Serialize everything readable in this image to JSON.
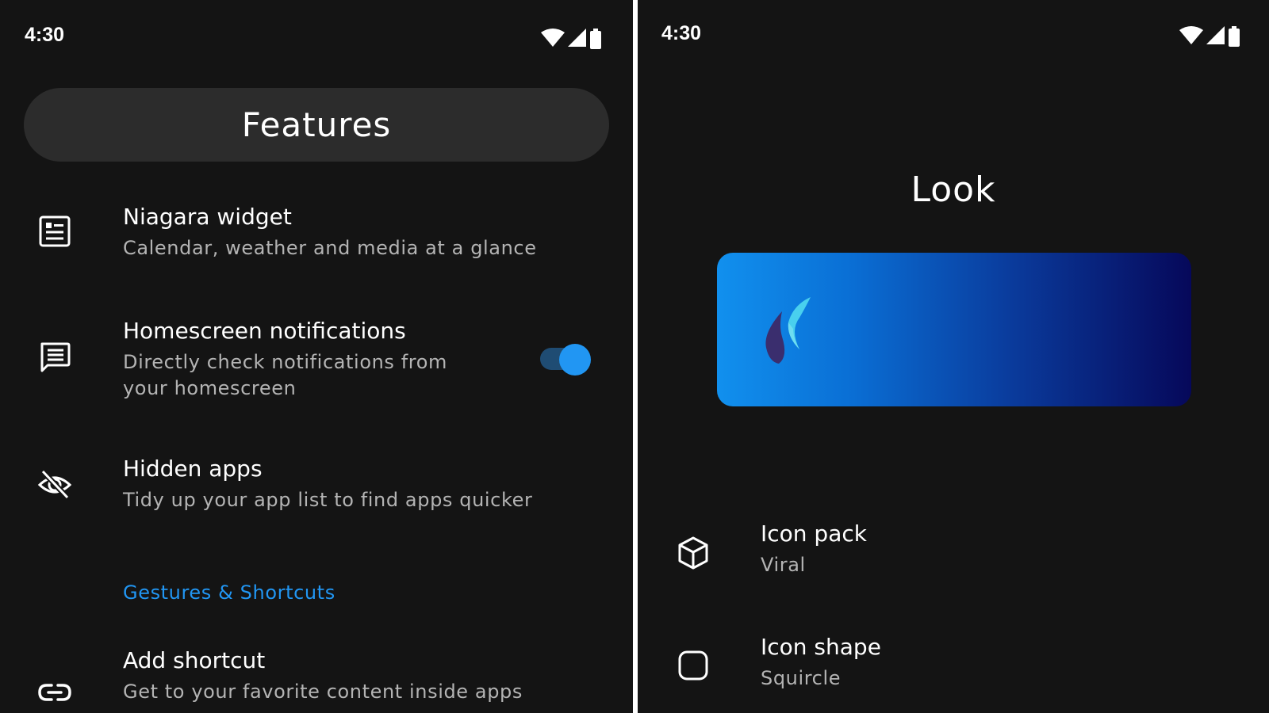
{
  "left_screen": {
    "status": {
      "time": "4:30"
    },
    "header": {
      "title": "Features"
    },
    "items": [
      {
        "icon": "article-icon",
        "title": "Niagara widget",
        "subtitle_lines": [
          "Calendar, weather and media at a glance"
        ]
      },
      {
        "icon": "chat-icon",
        "title": "Homescreen notifications",
        "subtitle_lines": [
          "Directly check notifications from",
          "your homescreen"
        ],
        "toggle_on": true
      },
      {
        "icon": "eye-off-icon",
        "title": "Hidden apps",
        "subtitle_lines": [
          "Tidy up your app list to find apps quicker"
        ]
      }
    ],
    "section": {
      "label": "Gestures & Shortcuts"
    },
    "shortcut_item": {
      "icon": "link-icon",
      "title": "Add shortcut",
      "subtitle": "Get to your favorite content inside apps"
    }
  },
  "right_screen": {
    "status": {
      "time": "4:30"
    },
    "header": {
      "title": "Look"
    },
    "items": [
      {
        "icon": "cube-icon",
        "title": "Icon pack",
        "subtitle": "Viral"
      },
      {
        "icon": "squircle-icon",
        "title": "Icon shape",
        "subtitle": "Squircle"
      }
    ]
  },
  "colors": {
    "background": "#141414",
    "pill": "#2c2c2c",
    "accent": "#2196f3",
    "subtitle": "#b4b4b4"
  }
}
